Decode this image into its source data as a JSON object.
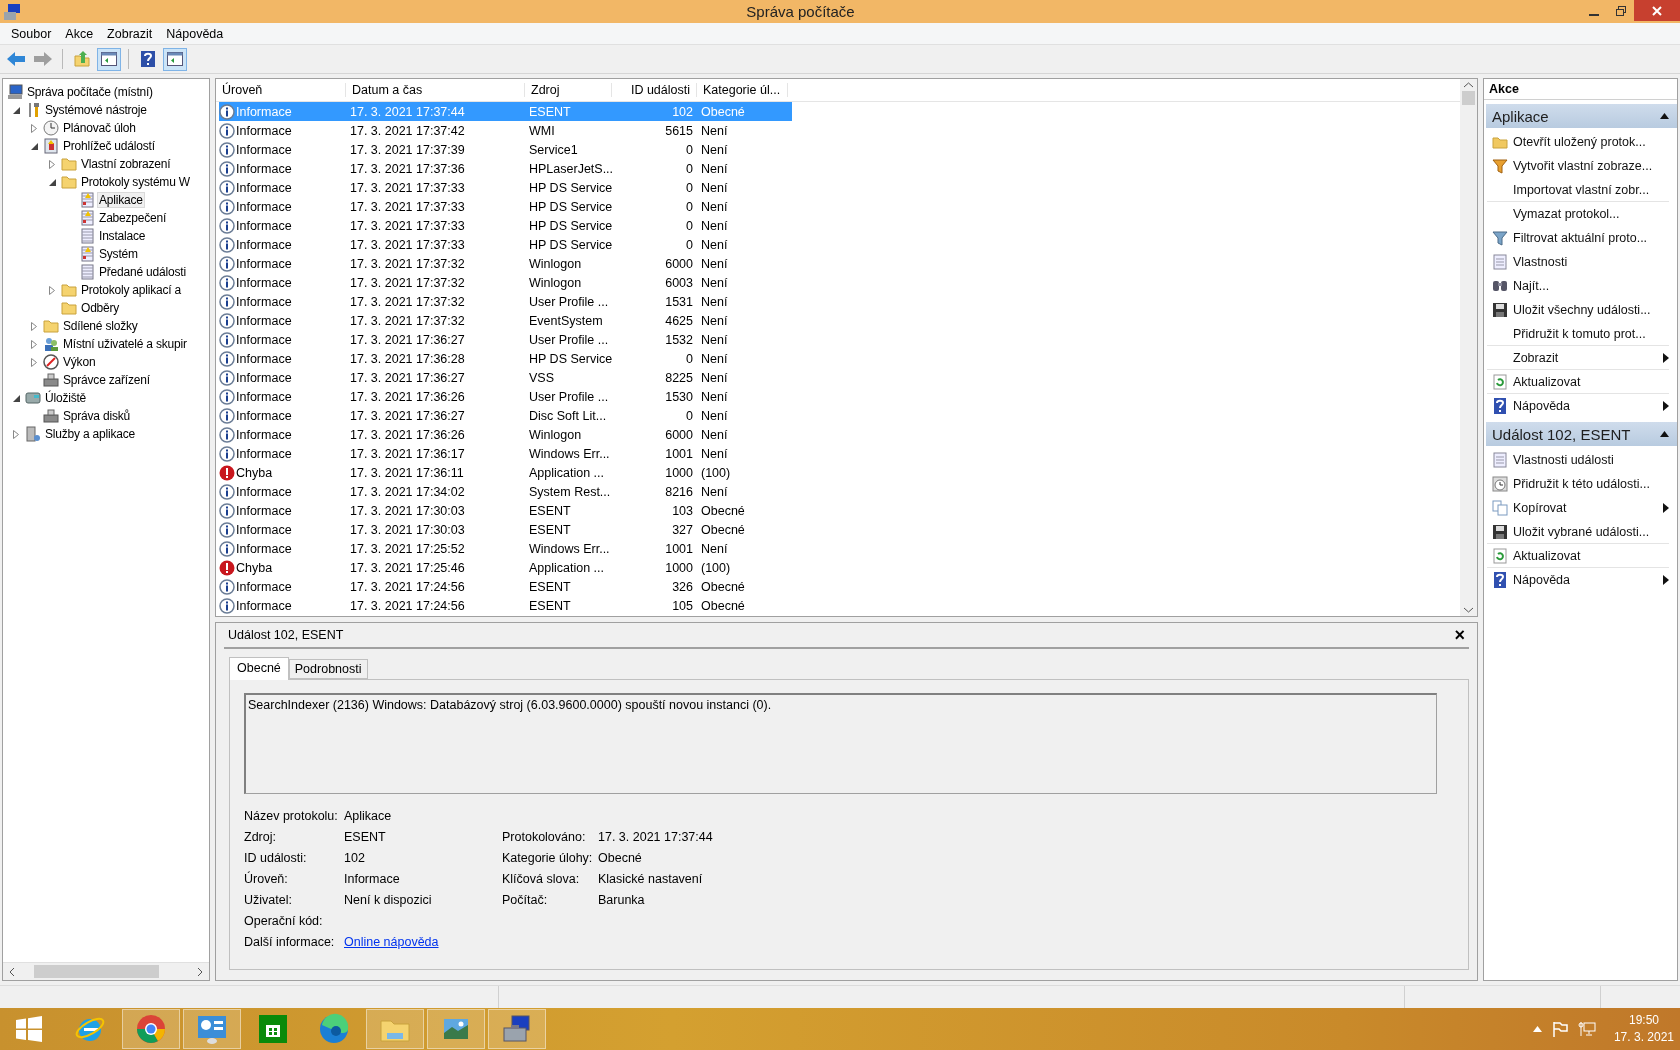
{
  "window": {
    "title": "Správa počítače"
  },
  "menu": [
    "Soubor",
    "Akce",
    "Zobrazit",
    "Nápověda"
  ],
  "toolbar": [
    {
      "kind": "back",
      "disabled": false,
      "pressed": false
    },
    {
      "kind": "forward",
      "disabled": true,
      "pressed": false
    },
    {
      "kind": "up",
      "disabled": false,
      "pressed": false
    },
    {
      "kind": "pane",
      "disabled": false,
      "pressed": true
    },
    {
      "kind": "help",
      "disabled": false,
      "pressed": false
    },
    {
      "kind": "pane",
      "disabled": false,
      "pressed": true
    }
  ],
  "tree": [
    {
      "label": "Správa počítače (místní)",
      "kind": "computer",
      "selected": false,
      "children": [
        {
          "label": "Systémové nástroje",
          "kind": "tools",
          "expanded": true,
          "selected": false,
          "children": [
            {
              "label": "Plánovač úloh",
              "kind": "clock",
              "expanded": false,
              "selected": false
            },
            {
              "label": "Prohlížeč událostí",
              "kind": "eventlog",
              "expanded": true,
              "selected": false,
              "children": [
                {
                  "label": "Vlastní zobrazení",
                  "kind": "folder",
                  "expanded": false,
                  "selected": false
                },
                {
                  "label": "Protokoly systému W",
                  "kind": "folder",
                  "expanded": true,
                  "selected": false,
                  "children": [
                    {
                      "label": "Aplikace",
                      "kind": "warnlog",
                      "selected": true
                    },
                    {
                      "label": "Zabezpečení",
                      "kind": "warnlog",
                      "selected": false
                    },
                    {
                      "label": "Instalace",
                      "kind": "log",
                      "selected": false
                    },
                    {
                      "label": "Systém",
                      "kind": "warnlog",
                      "selected": false
                    },
                    {
                      "label": "Předané události",
                      "kind": "log",
                      "selected": false
                    }
                  ]
                },
                {
                  "label": "Protokoly aplikací a",
                  "kind": "folder",
                  "expanded": false,
                  "selected": false
                },
                {
                  "label": "Odběry",
                  "kind": "folder",
                  "selected": false
                }
              ]
            },
            {
              "label": "Sdílené složky",
              "kind": "folder",
              "expanded": false,
              "selected": false
            },
            {
              "label": "Místní uživatelé a skupir",
              "kind": "users",
              "expanded": false,
              "selected": false
            },
            {
              "label": "Výkon",
              "kind": "perf",
              "expanded": false,
              "selected": false
            },
            {
              "label": "Správce zařízení",
              "kind": "device",
              "selected": false
            }
          ]
        },
        {
          "label": "Úložiště",
          "kind": "storage",
          "expanded": true,
          "selected": false,
          "children": [
            {
              "label": "Správa disků",
              "kind": "device",
              "selected": false
            }
          ]
        },
        {
          "label": "Služby a aplikace",
          "kind": "services",
          "expanded": false,
          "selected": false
        }
      ]
    }
  ],
  "table": {
    "columns": [
      "Úroveň",
      "Datum a čas",
      "Zdroj",
      "ID události",
      "Kategorie úl..."
    ],
    "rows": [
      {
        "kind": "info",
        "level": "Informace",
        "date": "17. 3. 2021 17:37:44",
        "source": "ESENT",
        "id": "102",
        "category": "Obecné",
        "selected": true
      },
      {
        "kind": "info",
        "level": "Informace",
        "date": "17. 3. 2021 17:37:42",
        "source": "WMI",
        "id": "5615",
        "category": "Není",
        "selected": false
      },
      {
        "kind": "info",
        "level": "Informace",
        "date": "17. 3. 2021 17:37:39",
        "source": "Service1",
        "id": "0",
        "category": "Není",
        "selected": false
      },
      {
        "kind": "info",
        "level": "Informace",
        "date": "17. 3. 2021 17:37:36",
        "source": "HPLaserJetS...",
        "id": "0",
        "category": "Není",
        "selected": false
      },
      {
        "kind": "info",
        "level": "Informace",
        "date": "17. 3. 2021 17:37:33",
        "source": "HP DS Service",
        "id": "0",
        "category": "Není",
        "selected": false
      },
      {
        "kind": "info",
        "level": "Informace",
        "date": "17. 3. 2021 17:37:33",
        "source": "HP DS Service",
        "id": "0",
        "category": "Není",
        "selected": false
      },
      {
        "kind": "info",
        "level": "Informace",
        "date": "17. 3. 2021 17:37:33",
        "source": "HP DS Service",
        "id": "0",
        "category": "Není",
        "selected": false
      },
      {
        "kind": "info",
        "level": "Informace",
        "date": "17. 3. 2021 17:37:33",
        "source": "HP DS Service",
        "id": "0",
        "category": "Není",
        "selected": false
      },
      {
        "kind": "info",
        "level": "Informace",
        "date": "17. 3. 2021 17:37:32",
        "source": "Winlogon",
        "id": "6000",
        "category": "Není",
        "selected": false
      },
      {
        "kind": "info",
        "level": "Informace",
        "date": "17. 3. 2021 17:37:32",
        "source": "Winlogon",
        "id": "6003",
        "category": "Není",
        "selected": false
      },
      {
        "kind": "info",
        "level": "Informace",
        "date": "17. 3. 2021 17:37:32",
        "source": "User Profile ...",
        "id": "1531",
        "category": "Není",
        "selected": false
      },
      {
        "kind": "info",
        "level": "Informace",
        "date": "17. 3. 2021 17:37:32",
        "source": "EventSystem",
        "id": "4625",
        "category": "Není",
        "selected": false
      },
      {
        "kind": "info",
        "level": "Informace",
        "date": "17. 3. 2021 17:36:27",
        "source": "User Profile ...",
        "id": "1532",
        "category": "Není",
        "selected": false
      },
      {
        "kind": "info",
        "level": "Informace",
        "date": "17. 3. 2021 17:36:28",
        "source": "HP DS Service",
        "id": "0",
        "category": "Není",
        "selected": false
      },
      {
        "kind": "info",
        "level": "Informace",
        "date": "17. 3. 2021 17:36:27",
        "source": "VSS",
        "id": "8225",
        "category": "Není",
        "selected": false
      },
      {
        "kind": "info",
        "level": "Informace",
        "date": "17. 3. 2021 17:36:26",
        "source": "User Profile ...",
        "id": "1530",
        "category": "Není",
        "selected": false
      },
      {
        "kind": "info",
        "level": "Informace",
        "date": "17. 3. 2021 17:36:27",
        "source": "Disc Soft Lit...",
        "id": "0",
        "category": "Není",
        "selected": false
      },
      {
        "kind": "info",
        "level": "Informace",
        "date": "17. 3. 2021 17:36:26",
        "source": "Winlogon",
        "id": "6000",
        "category": "Není",
        "selected": false
      },
      {
        "kind": "info",
        "level": "Informace",
        "date": "17. 3. 2021 17:36:17",
        "source": "Windows Err...",
        "id": "1001",
        "category": "Není",
        "selected": false
      },
      {
        "kind": "error",
        "level": "Chyba",
        "date": "17. 3. 2021 17:36:11",
        "source": "Application ...",
        "id": "1000",
        "category": "(100)",
        "selected": false
      },
      {
        "kind": "info",
        "level": "Informace",
        "date": "17. 3. 2021 17:34:02",
        "source": "System Rest...",
        "id": "8216",
        "category": "Není",
        "selected": false
      },
      {
        "kind": "info",
        "level": "Informace",
        "date": "17. 3. 2021 17:30:03",
        "source": "ESENT",
        "id": "103",
        "category": "Obecné",
        "selected": false
      },
      {
        "kind": "info",
        "level": "Informace",
        "date": "17. 3. 2021 17:30:03",
        "source": "ESENT",
        "id": "327",
        "category": "Obecné",
        "selected": false
      },
      {
        "kind": "info",
        "level": "Informace",
        "date": "17. 3. 2021 17:25:52",
        "source": "Windows Err...",
        "id": "1001",
        "category": "Není",
        "selected": false
      },
      {
        "kind": "error",
        "level": "Chyba",
        "date": "17. 3. 2021 17:25:46",
        "source": "Application ...",
        "id": "1000",
        "category": "(100)",
        "selected": false
      },
      {
        "kind": "info",
        "level": "Informace",
        "date": "17. 3. 2021 17:24:56",
        "source": "ESENT",
        "id": "326",
        "category": "Obecné",
        "selected": false
      },
      {
        "kind": "info",
        "level": "Informace",
        "date": "17. 3. 2021 17:24:56",
        "source": "ESENT",
        "id": "105",
        "category": "Obecné",
        "selected": false
      }
    ]
  },
  "detail": {
    "title": "Událost 102, ESENT",
    "close": "×",
    "tabs": [
      {
        "label": "Obecné",
        "selected": true
      },
      {
        "label": "Podrobnosti",
        "selected": false
      }
    ],
    "message": "SearchIndexer (2136) Windows: Databázový stroj (6.03.9600.0000) spouští novou instanci (0).",
    "rows": [
      {
        "left": {
          "label": "Název protokolu:",
          "value": "Aplikace"
        }
      },
      {
        "left": {
          "label": "Zdroj:",
          "value": "ESENT"
        },
        "right": {
          "label": "Protokolováno:",
          "value": "17. 3. 2021 17:37:44"
        }
      },
      {
        "left": {
          "label": "ID události:",
          "value": "102"
        },
        "right": {
          "label": "Kategorie úlohy:",
          "value": "Obecné"
        }
      },
      {
        "left": {
          "label": "Úroveň:",
          "value": "Informace"
        },
        "right": {
          "label": "Klíčová slova:",
          "value": "Klasické nastavení"
        }
      },
      {
        "left": {
          "label": "Uživatel:",
          "value": "Není k dispozici"
        },
        "right": {
          "label": "Počítač:",
          "value": "Barunka"
        }
      },
      {
        "left": {
          "label": "Operační kód:"
        }
      },
      {
        "left": {
          "label": "Další informace:",
          "link": "Online nápověda"
        }
      }
    ]
  },
  "actions": {
    "title": "Akce",
    "sections": [
      {
        "title": "Aplikace",
        "expanded": true,
        "items": [
          {
            "label": "Otevřít uložený protok...",
            "kind": "folder",
            "submenu": false,
            "divider": false
          },
          {
            "label": "Vytvořit vlastní zobraze...",
            "kind": "filter-color",
            "submenu": false,
            "divider": false
          },
          {
            "label": "Importovat vlastní zobr...",
            "kind": "blank",
            "submenu": false,
            "divider": true
          },
          {
            "label": "Vymazat protokol...",
            "kind": "blank",
            "submenu": false,
            "divider": false
          },
          {
            "label": "Filtrovat aktuální proto...",
            "kind": "filter",
            "submenu": false,
            "divider": false
          },
          {
            "label": "Vlastnosti",
            "kind": "properties",
            "submenu": false,
            "divider": false
          },
          {
            "label": "Najít...",
            "kind": "find",
            "submenu": false,
            "divider": false
          },
          {
            "label": "Uložit všechny události...",
            "kind": "save",
            "submenu": false,
            "divider": false
          },
          {
            "label": "Přidružit k tomuto prot...",
            "kind": "blank",
            "submenu": false,
            "divider": true
          },
          {
            "label": "Zobrazit",
            "kind": "blank",
            "submenu": true,
            "divider": true
          },
          {
            "label": "Aktualizovat",
            "kind": "refresh",
            "submenu": false,
            "divider": true
          },
          {
            "label": "Nápověda",
            "kind": "help",
            "submenu": true,
            "divider": false
          }
        ]
      },
      {
        "title": "Událost 102, ESENT",
        "expanded": true,
        "items": [
          {
            "label": "Vlastnosti události",
            "kind": "properties",
            "submenu": false,
            "divider": false
          },
          {
            "label": "Přidružit k této události...",
            "kind": "attach",
            "submenu": false,
            "divider": false
          },
          {
            "label": "Kopírovat",
            "kind": "copy",
            "submenu": true,
            "divider": false
          },
          {
            "label": "Uložit vybrané události...",
            "kind": "save",
            "submenu": false,
            "divider": true
          },
          {
            "label": "Aktualizovat",
            "kind": "refresh",
            "submenu": false,
            "divider": true
          },
          {
            "label": "Nápověda",
            "kind": "help",
            "submenu": true,
            "divider": false
          }
        ]
      }
    ]
  },
  "taskbar": {
    "apps": [
      {
        "kind": "ie",
        "pressed": false
      },
      {
        "kind": "chrome",
        "pressed": true
      },
      {
        "kind": "control",
        "pressed": true
      },
      {
        "kind": "store",
        "pressed": false
      },
      {
        "kind": "edge",
        "pressed": false
      },
      {
        "kind": "explorer",
        "pressed": true
      },
      {
        "kind": "photos",
        "pressed": true
      },
      {
        "kind": "mgmt",
        "pressed": true
      }
    ],
    "time": "19:50",
    "date": "17. 3. 2021"
  }
}
